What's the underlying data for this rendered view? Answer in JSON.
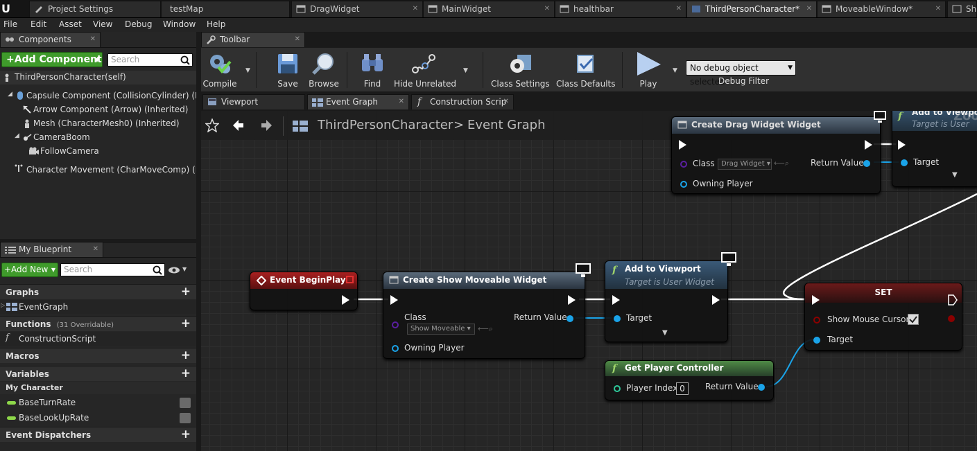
{
  "tabs": [
    {
      "label": "Project Settings"
    },
    {
      "label": "testMap"
    },
    {
      "label": "DragWidget"
    },
    {
      "label": "MainWidget"
    },
    {
      "label": "healthbar"
    },
    {
      "label": "ThirdPersonCharacter*"
    },
    {
      "label": "MoveableWindow*"
    },
    {
      "label": "Sh"
    }
  ],
  "menu": [
    "File",
    "Edit",
    "Asset",
    "View",
    "Debug",
    "Window",
    "Help"
  ],
  "components": {
    "tab_label": "Components",
    "add_button": "+Add Component",
    "search_placeholder": "Search",
    "root": "ThirdPersonCharacter(self)",
    "items": [
      "Capsule Component (CollisionCylinder) (Inhe",
      "Arrow Component (Arrow) (Inherited)",
      "Mesh (CharacterMesh0) (Inherited)",
      "CameraBoom",
      "FollowCamera",
      "Character Movement (CharMoveComp) (Inhe"
    ]
  },
  "blueprint": {
    "tab_label": "My Blueprint",
    "add_button": "+Add New",
    "search_placeholder": "Search",
    "graphs_label": "Graphs",
    "event_graph": "EventGraph",
    "functions_label": "Functions",
    "functions_count": "(31 Overridable)",
    "construction_script": "ConstructionScript",
    "macros_label": "Macros",
    "variables_label": "Variables",
    "my_character": "My Character",
    "vars": [
      "BaseTurnRate",
      "BaseLookUpRate"
    ],
    "dispatchers_label": "Event Dispatchers"
  },
  "toolbar": {
    "tab_label": "Toolbar",
    "compile": "Compile",
    "save": "Save",
    "browse": "Browse",
    "find": "Find",
    "hide_unrelated": "Hide Unrelated",
    "class_settings": "Class Settings",
    "class_defaults": "Class Defaults",
    "play": "Play",
    "debug_select": "No debug object selected",
    "debug_filter": "Debug Filter"
  },
  "editor_tabs": [
    "Viewport",
    "Event Graph",
    "Construction Scrip"
  ],
  "breadcrumb": {
    "root": "ThirdPersonCharacter",
    "sep": ">",
    "current": "Event Graph"
  },
  "nodes": {
    "begin_play": {
      "title": "Event BeginPlay"
    },
    "create_show": {
      "title": "Create Show Moveable Widget",
      "class_label": "Class",
      "class_value": "Show Moveable",
      "return_label": "Return Value",
      "owning_label": "Owning Player"
    },
    "add_viewport": {
      "title": "Add to Viewport",
      "subtitle": "Target is User Widget",
      "target_label": "Target"
    },
    "get_pc": {
      "title": "Get Player Controller",
      "index_label": "Player Index",
      "index_value": "0",
      "return_label": "Return Value"
    },
    "set": {
      "title": "SET",
      "cursor_label": "Show Mouse Cursor",
      "target_label": "Target"
    },
    "create_drag": {
      "title": "Create Drag Widget Widget",
      "class_label": "Class",
      "class_value": "Drag Widget",
      "return_label": "Return Value",
      "owning_label": "Owning Player"
    },
    "add_viewport2": {
      "title": "Add to Viewport",
      "subtitle": "Target is User",
      "target_label": "Target"
    }
  },
  "zoom_label": "Zoom",
  "colors": {
    "exec": "#ffffff",
    "object_pin": "#1aa3e8",
    "class_pin": "#5a1fa0",
    "bool_pin": "#8b0000",
    "event_header": "#8b1a1a",
    "function_header": "#3a5a78",
    "pure_header": "#3f6a3a",
    "set_header": "#6a1010",
    "add_button": "#3f9a2b"
  }
}
